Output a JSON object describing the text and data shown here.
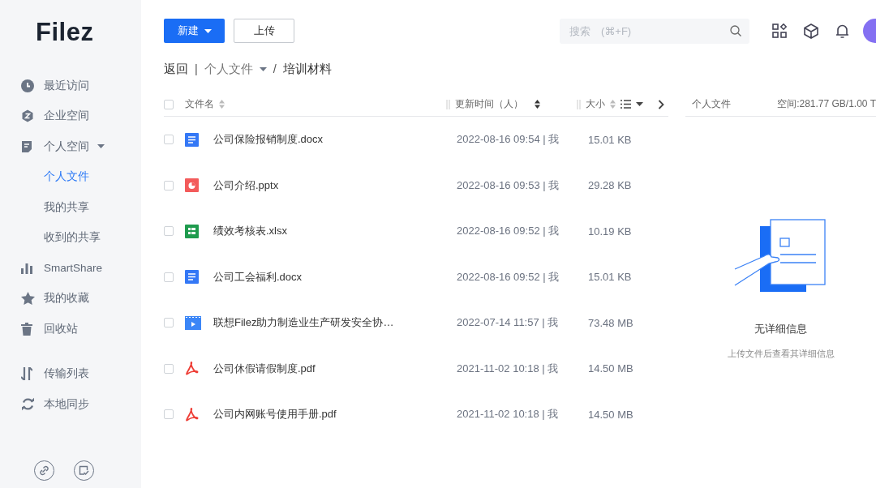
{
  "logo": "Filez",
  "sidebar": {
    "items": [
      {
        "label": "最近访问",
        "kind": "item",
        "selected": false
      },
      {
        "label": "企业空间",
        "kind": "item",
        "selected": false
      },
      {
        "label": "个人空间",
        "kind": "group",
        "selected": false,
        "expanded": true
      },
      {
        "label": "个人文件",
        "kind": "sub",
        "selected": true
      },
      {
        "label": "我的共享",
        "kind": "sub",
        "selected": false
      },
      {
        "label": "收到的共享",
        "kind": "sub",
        "selected": false
      },
      {
        "label": "SmartShare",
        "kind": "item",
        "selected": false
      },
      {
        "label": "我的收藏",
        "kind": "item",
        "selected": false
      },
      {
        "label": "回收站",
        "kind": "item",
        "selected": false
      },
      {
        "label": "传输列表",
        "kind": "item",
        "selected": false
      },
      {
        "label": "本地同步",
        "kind": "item",
        "selected": false
      }
    ]
  },
  "toolbar": {
    "new_button": "新建",
    "upload_button": "上传",
    "search": {
      "placeholder": "搜索　(⌘+F)"
    }
  },
  "breadcrumb": {
    "back": "返回",
    "separator": "|",
    "parent": "个人文件",
    "slash": "/",
    "current": "培训材料"
  },
  "table": {
    "header_checked": false,
    "columns": [
      "文件名",
      "更新时间（人）",
      "大小"
    ],
    "rows": [
      {
        "kind": "doc",
        "name": "公司保险报销制度.docx",
        "updated": "2022-08-16 09:54 | 我",
        "size": "15.01 KB",
        "checked": false
      },
      {
        "kind": "ppt",
        "name": "公司介绍.pptx",
        "updated": "2022-08-16 09:53 | 我",
        "size": "29.28 KB",
        "checked": false
      },
      {
        "kind": "xls",
        "name": "绩效考核表.xlsx",
        "updated": "2022-08-16 09:52 | 我",
        "size": "10.19 KB",
        "checked": false
      },
      {
        "kind": "doc",
        "name": "公司工会福利.docx",
        "updated": "2022-08-16 09:52 | 我",
        "size": "15.01 KB",
        "checked": false
      },
      {
        "kind": "video",
        "name": "联想Filez助力制造业生产研发安全协…",
        "updated": "2022-07-14 11:57 | 我",
        "size": "73.48 MB",
        "checked": false
      },
      {
        "kind": "pdf",
        "name": "公司休假请假制度.pdf",
        "updated": "2021-11-02 10:18 | 我",
        "size": "14.50 MB",
        "checked": false
      },
      {
        "kind": "pdf",
        "name": "公司内网账号使用手册.pdf",
        "updated": "2021-11-02 10:18 | 我",
        "size": "14.50 MB",
        "checked": false
      }
    ]
  },
  "detail_panel": {
    "title": "个人文件",
    "space": "空间:281.77 GB/1.00 T",
    "empty_title": "无详细信息",
    "empty_hint": "上传文件后查看其详细信息"
  }
}
